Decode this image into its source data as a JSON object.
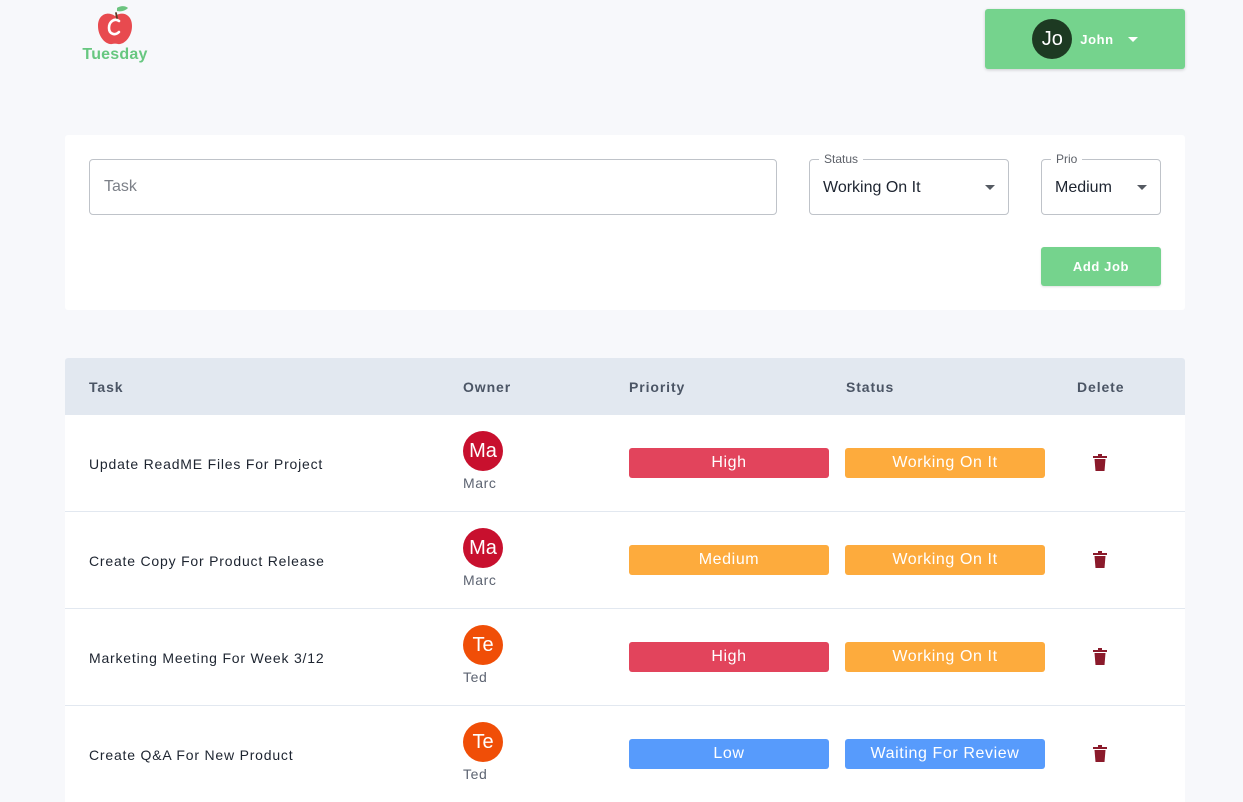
{
  "app": {
    "logo_text": "Tuesday"
  },
  "user": {
    "initials": "Jo",
    "name": "John",
    "avatar_color": "#1d3a22",
    "menu_color": "#75d38d"
  },
  "form": {
    "task_placeholder": "Task",
    "task_value": "",
    "status_label": "Status",
    "status_value": "Working On It",
    "prio_label": "Prio",
    "prio_value": "Medium",
    "add_button": "Add Job"
  },
  "table": {
    "headers": {
      "task": "Task",
      "owner": "Owner",
      "priority": "Priority",
      "status": "Status",
      "delete": "Delete"
    },
    "rows": [
      {
        "task": "Update ReadME Files For Project",
        "owner_initials": "Ma",
        "owner_name": "Marc",
        "owner_color": "#c8102e",
        "priority": "High",
        "priority_color": "#e2445c",
        "status": "Working On It",
        "status_color": "#fdab3d"
      },
      {
        "task": "Create Copy For Product Release",
        "owner_initials": "Ma",
        "owner_name": "Marc",
        "owner_color": "#c8102e",
        "priority": "Medium",
        "priority_color": "#fdab3d",
        "status": "Working On It",
        "status_color": "#fdab3d"
      },
      {
        "task": "Marketing Meeting For Week 3/12",
        "owner_initials": "Te",
        "owner_name": "Ted",
        "owner_color": "#f04e07",
        "priority": "High",
        "priority_color": "#e2445c",
        "status": "Working On It",
        "status_color": "#fdab3d"
      },
      {
        "task": "Create Q&A For New Product",
        "owner_initials": "Te",
        "owner_name": "Ted",
        "owner_color": "#f04e07",
        "priority": "Low",
        "priority_color": "#579bfc",
        "status": "Waiting For Review",
        "status_color": "#579bfc"
      }
    ],
    "delete_icon": "trash-icon",
    "delete_color": "#8b1a2b"
  }
}
